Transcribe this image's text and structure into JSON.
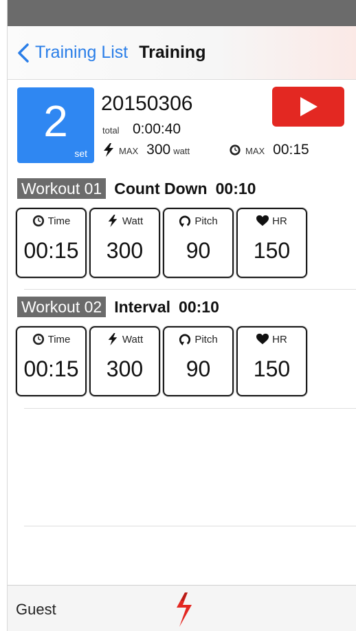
{
  "nav": {
    "back_label": "Training List",
    "title": "Training"
  },
  "summary": {
    "set_count": "2",
    "set_label": "set",
    "date": "20150306",
    "total_label": "total",
    "total_value": "0:00:40",
    "max_watt_label": "MAX",
    "max_watt_value": "300",
    "max_watt_unit": "watt",
    "max_time_label": "MAX",
    "max_time_value": "00:15"
  },
  "workouts": [
    {
      "badge": "Workout 01",
      "type": "Count Down",
      "duration": "00:10",
      "metrics": [
        {
          "label": "Time",
          "value": "00:15",
          "icon": "clock-icon"
        },
        {
          "label": "Watt",
          "value": "300",
          "icon": "lightning-icon"
        },
        {
          "label": "Pitch",
          "value": "90",
          "icon": "rotate-icon"
        },
        {
          "label": "HR",
          "value": "150",
          "icon": "heart-icon"
        }
      ]
    },
    {
      "badge": "Workout 02",
      "type": "Interval",
      "duration": "00:10",
      "metrics": [
        {
          "label": "Time",
          "value": "00:15",
          "icon": "clock-icon"
        },
        {
          "label": "Watt",
          "value": "300",
          "icon": "lightning-icon"
        },
        {
          "label": "Pitch",
          "value": "90",
          "icon": "rotate-icon"
        },
        {
          "label": "HR",
          "value": "150",
          "icon": "heart-icon"
        }
      ]
    }
  ],
  "tab_bar": {
    "user_label": "Guest"
  },
  "colors": {
    "accent_blue": "#2f87f2",
    "link_blue": "#2a7ee8",
    "play_red": "#e32822",
    "badge_gray": "#6b6b6b"
  }
}
